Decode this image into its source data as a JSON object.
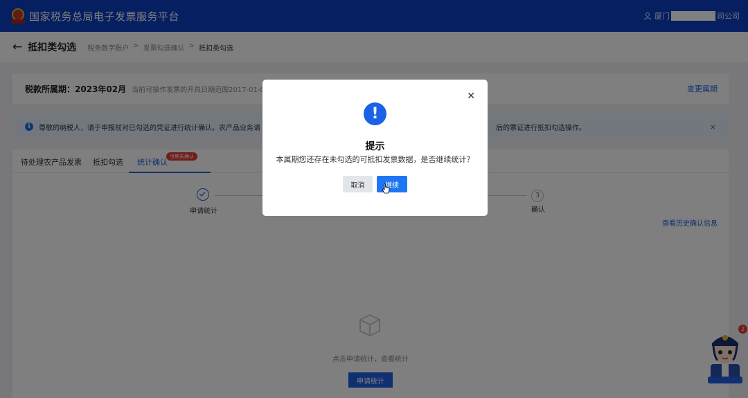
{
  "header": {
    "site_title": "国家税务总局电子发票服务平台",
    "user_prefix": "厦门",
    "user_suffix": "司公司"
  },
  "subheader": {
    "page_title": "抵扣类勾选",
    "breadcrumb": [
      "税务数字账户",
      "发票勾选确认",
      "抵扣类勾选"
    ]
  },
  "period": {
    "label": "税款所属期：2023年02月",
    "note": "当前可操作发票的开具日期范围2017-01-01",
    "change_label": "变更属期"
  },
  "notice": {
    "text": "尊敬的纳税人，请于申报前对已勾选的凭证进行统计确认。农产品业务请",
    "text_tail": "后的票证进行抵扣勾选操作。"
  },
  "tabs": [
    {
      "label": "待处理农产品发票"
    },
    {
      "label": "抵扣勾选"
    },
    {
      "label": "统计确认",
      "badge": "当期未确认"
    }
  ],
  "steps": [
    {
      "label": "申请统计",
      "state": "done"
    },
    {
      "label": "确认",
      "number": "3"
    }
  ],
  "history_link": "查看历史确认信息",
  "empty_state": {
    "text": "点击申请统计，查看统计",
    "button": "申请统计"
  },
  "mascot": {
    "badge_count": "2"
  },
  "modal": {
    "title": "提示",
    "message": "本属期您还存在未勾选的可抵扣发票数据，是否继续统计？",
    "cancel_label": "取消",
    "continue_label": "继续"
  },
  "colors": {
    "brand_blue": "#0a3fc2",
    "primary": "#1f5fe0",
    "badge_red": "#e23b30"
  }
}
